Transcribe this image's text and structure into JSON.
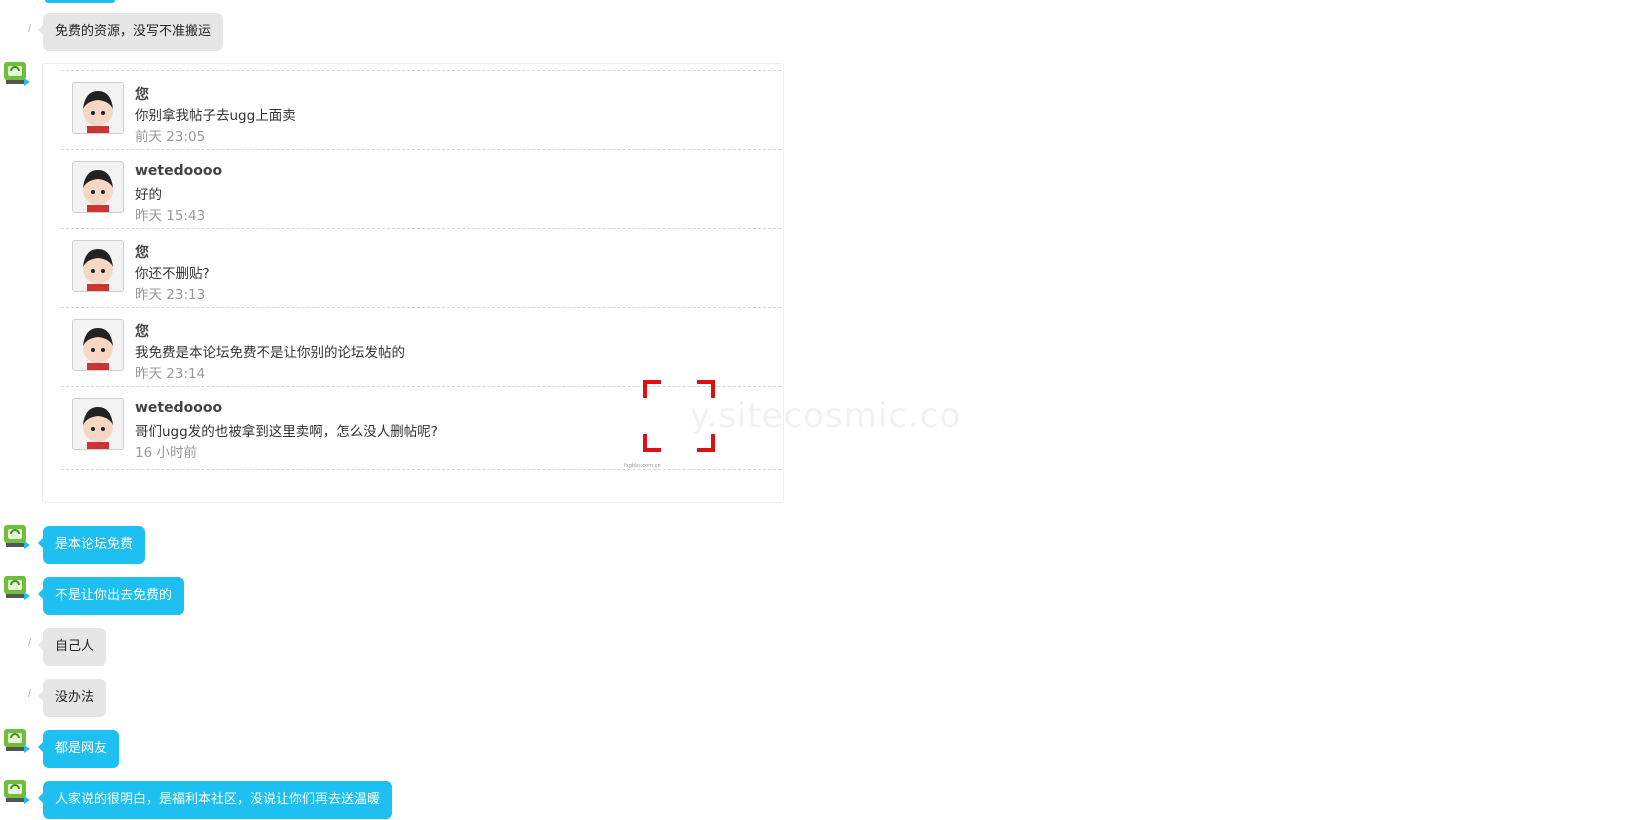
{
  "messages_top": [
    {
      "text": "免费的资源，没写不准搬运",
      "style": "gray"
    }
  ],
  "quoted_thread": [
    {
      "name": "您",
      "text": "你别拿我帖子去ugg上面卖",
      "time": "前天 23:05"
    },
    {
      "name": "wetedoooo",
      "text": "好的",
      "time": "昨天 15:43"
    },
    {
      "name": "您",
      "text": "你还不删贴?",
      "time": "昨天 23:13"
    },
    {
      "name": "您",
      "text": "我免费是本论坛免费不是让你别的论坛发帖的",
      "time": "昨天 23:14"
    },
    {
      "name": "wetedoooo",
      "text": "哥们ugg发的也被拿到这里卖啊，怎么没人删帖呢?",
      "time": "16 小时前"
    }
  ],
  "messages_bottom": [
    {
      "text": "是本论坛免费",
      "style": "blue"
    },
    {
      "text": "不是让你出去免费的",
      "style": "blue"
    },
    {
      "text": "自己人",
      "style": "gray"
    },
    {
      "text": "没办法",
      "style": "gray"
    },
    {
      "text": "都是网友",
      "style": "blue"
    },
    {
      "text": "人家说的很明白，是福利本社区，没说让你们再去送温暖",
      "style": "blue"
    }
  ],
  "watermark": {
    "text": "y.sitecosmic.co",
    "small": "fxgbbs.com.cn"
  },
  "colors": {
    "blue_bubble": "#1dc0f0",
    "gray_bubble": "#e6e6e6",
    "watermark_red": "#dd1111"
  }
}
